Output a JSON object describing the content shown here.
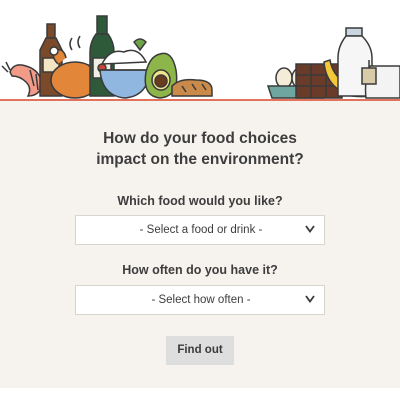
{
  "banner": {
    "illustrations": [
      "shrimp-icon",
      "beer-bottle-icon",
      "roast-chicken-icon",
      "wine-bottle-icon",
      "rice-bowl-icon",
      "avocado-icon",
      "bread-icon",
      "eggs-carton-icon",
      "chocolate-icon",
      "banana-icon",
      "milk-bottle-icon",
      "tea-cup-icon"
    ],
    "accent_color": "#e2725b"
  },
  "heading": {
    "line1": "How do your food choices",
    "line2": "impact on the environment?"
  },
  "food": {
    "label": "Which food would you like?",
    "selected": "- Select a food or drink -"
  },
  "frequency": {
    "label": "How often do you have it?",
    "selected": "- Select how often -"
  },
  "submit": {
    "label": "Find out"
  },
  "colors": {
    "background": "#f6f3ef",
    "button": "#dedede",
    "text": "#3d3d3d"
  }
}
